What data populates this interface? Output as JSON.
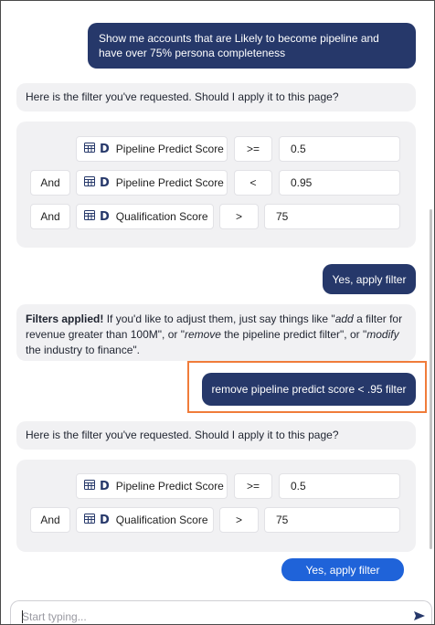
{
  "messages": {
    "user_1": "Show me accounts that are Likely to become pipeline and have over 75% persona completeness",
    "bot_1": "Here is the filter you've requested. Should I apply it to this page?",
    "user_2": "Yes, apply filter",
    "bot_2": {
      "bold": "Filters applied!",
      "t1": " If you'd like to adjust them, just say things like \"",
      "i1": "add",
      "t2": " a filter for revenue greater than 100M\", or \"",
      "i2": "remove",
      "t3": " the pipeline predict filter\", or \"",
      "i3": "modify",
      "t4": " the industry to finance\"."
    },
    "user_3": "remove pipeline predict score < .95 filter",
    "bot_3": "Here is the filter you've requested. Should I apply it to this page?"
  },
  "filter_set_1": [
    {
      "connector": "",
      "field": "Pipeline Predict Score",
      "operator": ">=",
      "value": "0.5"
    },
    {
      "connector": "And",
      "field": "Pipeline Predict Score",
      "operator": "<",
      "value": "0.95"
    },
    {
      "connector": "And",
      "field": "Qualification Score",
      "operator": ">",
      "value": "75"
    }
  ],
  "filter_set_2": [
    {
      "connector": "",
      "field": "Pipeline Predict Score",
      "operator": ">=",
      "value": "0.5"
    },
    {
      "connector": "And",
      "field": "Qualification Score",
      "operator": ">",
      "value": "75"
    }
  ],
  "apply_button_label": "Yes, apply filter",
  "input": {
    "placeholder": "Start typing..."
  },
  "icons": {
    "field": "table-icon",
    "brand": "d-logo-icon",
    "send": "send-icon"
  },
  "colors": {
    "user_bubble": "#26386a",
    "apply_button": "#1f63d9",
    "highlight": "#f07c3a"
  }
}
